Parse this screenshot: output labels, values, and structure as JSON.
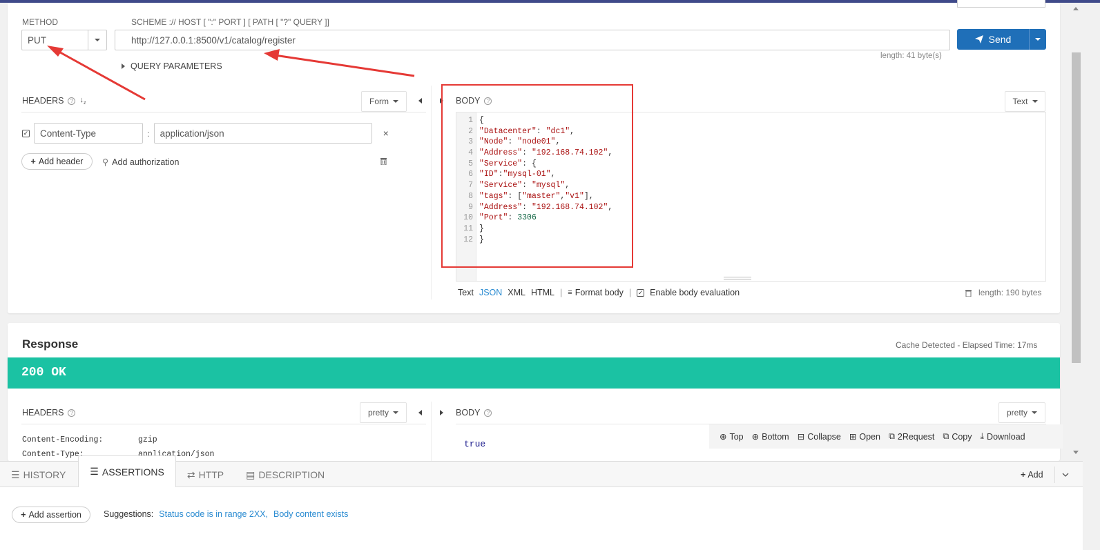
{
  "request": {
    "method_label": "METHOD",
    "method_value": "PUT",
    "url_label": "SCHEME :// HOST [ \":\" PORT ] [ PATH [ \"?\" QUERY ]]",
    "url_value": "http://127.0.0.1:8500/v1/catalog/register",
    "send_label": "Send",
    "url_length": "length: 41 byte(s)",
    "query_params_label": "QUERY PARAMETERS"
  },
  "headers": {
    "title": "HEADERS",
    "mode": "Form",
    "items": [
      {
        "key": "Content-Type",
        "value": "application/json",
        "checked": true
      }
    ],
    "add_header": "Add header",
    "add_auth": "Add authorization"
  },
  "body": {
    "title": "BODY",
    "mode": "Text",
    "lines": [
      {
        "n": "1",
        "t": [
          {
            "c": "p",
            "v": "{"
          }
        ]
      },
      {
        "n": "2",
        "t": [
          {
            "c": "k",
            "v": "\"Datacenter\""
          },
          {
            "c": "p",
            "v": ": "
          },
          {
            "c": "k",
            "v": "\"dc1\""
          },
          {
            "c": "p",
            "v": ","
          }
        ]
      },
      {
        "n": "3",
        "t": [
          {
            "c": "k",
            "v": "\"Node\""
          },
          {
            "c": "p",
            "v": ": "
          },
          {
            "c": "k",
            "v": "\"node01\""
          },
          {
            "c": "p",
            "v": ","
          }
        ]
      },
      {
        "n": "4",
        "t": [
          {
            "c": "k",
            "v": "\"Address\""
          },
          {
            "c": "p",
            "v": ": "
          },
          {
            "c": "k",
            "v": "\"192.168.74.102\""
          },
          {
            "c": "p",
            "v": ","
          }
        ]
      },
      {
        "n": "5",
        "t": [
          {
            "c": "k",
            "v": "\"Service\""
          },
          {
            "c": "p",
            "v": ": {"
          }
        ]
      },
      {
        "n": "6",
        "t": [
          {
            "c": "k",
            "v": "\"ID\""
          },
          {
            "c": "p",
            "v": ":"
          },
          {
            "c": "k",
            "v": "\"mysql-01\""
          },
          {
            "c": "p",
            "v": ","
          }
        ]
      },
      {
        "n": "7",
        "t": [
          {
            "c": "k",
            "v": "\"Service\""
          },
          {
            "c": "p",
            "v": ": "
          },
          {
            "c": "k",
            "v": "\"mysql\""
          },
          {
            "c": "p",
            "v": ","
          }
        ]
      },
      {
        "n": "8",
        "t": [
          {
            "c": "k",
            "v": "\"tags\""
          },
          {
            "c": "p",
            "v": ": ["
          },
          {
            "c": "k",
            "v": "\"master\""
          },
          {
            "c": "p",
            "v": ","
          },
          {
            "c": "k",
            "v": "\"v1\""
          },
          {
            "c": "p",
            "v": "],"
          }
        ]
      },
      {
        "n": "9",
        "t": [
          {
            "c": "k",
            "v": "\"Address\""
          },
          {
            "c": "p",
            "v": ": "
          },
          {
            "c": "k",
            "v": "\"192.168.74.102\""
          },
          {
            "c": "p",
            "v": ","
          }
        ]
      },
      {
        "n": "10",
        "t": [
          {
            "c": "k",
            "v": "\"Port\""
          },
          {
            "c": "p",
            "v": ": "
          },
          {
            "c": "n",
            "v": "3306"
          }
        ]
      },
      {
        "n": "11",
        "t": [
          {
            "c": "p",
            "v": "}"
          }
        ]
      },
      {
        "n": "12",
        "t": [
          {
            "c": "p",
            "v": "}"
          }
        ]
      }
    ],
    "formats": [
      "Text",
      "JSON",
      "XML",
      "HTML"
    ],
    "active_format": "JSON",
    "format_body": "Format body",
    "enable_eval": "Enable body evaluation",
    "length": "length: 190 bytes"
  },
  "response": {
    "title": "Response",
    "cache_info": "Cache Detected - Elapsed Time: 17ms",
    "status": "200 OK",
    "status_color": "#1bc2a3",
    "headers_title": "HEADERS",
    "headers_mode": "pretty",
    "headers": [
      {
        "k": "Content-Encoding:",
        "v": "gzip"
      },
      {
        "k": "Content-Type:",
        "v": "application/json"
      }
    ],
    "body_title": "BODY",
    "body_mode": "pretty",
    "body_value": "true",
    "toolbar": [
      "Top",
      "Bottom",
      "Collapse",
      "Open",
      "2Request",
      "Copy",
      "Download"
    ]
  },
  "bottom": {
    "tabs": [
      "HISTORY",
      "ASSERTIONS",
      "HTTP",
      "DESCRIPTION"
    ],
    "active_tab": "ASSERTIONS",
    "add_label": "Add",
    "add_assertion": "Add assertion",
    "suggestions_label": "Suggestions:",
    "suggestions": [
      "Status code is in range 2XX,",
      "Body content exists"
    ]
  },
  "colors": {
    "accent": "#1f6fb8",
    "annotation": "#e53935"
  }
}
